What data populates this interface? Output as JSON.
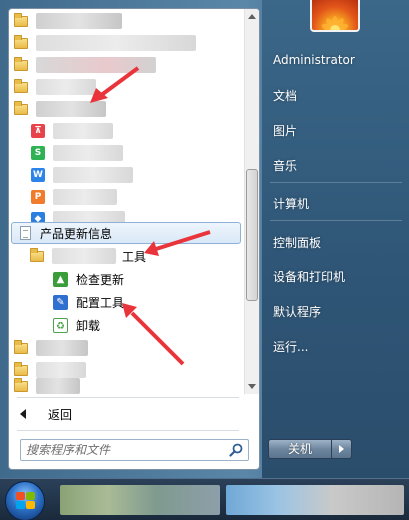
{
  "programs": {
    "app_icons": [
      {
        "name": "wps-pdf-icon",
        "glyph": "⊼",
        "color": "#e8434b"
      },
      {
        "name": "wps-spreadsheet-icon",
        "glyph": "S",
        "color": "#2fb254"
      },
      {
        "name": "wps-writer-icon",
        "glyph": "W",
        "color": "#2d84e8"
      },
      {
        "name": "wps-presentation-icon",
        "glyph": "P",
        "color": "#f07b2a"
      },
      {
        "name": "cube-app-icon",
        "glyph": "◆",
        "color": "#2b7fe0"
      }
    ],
    "selected_item": "产品更新信息",
    "folder_suffix": "工具",
    "sub_items": [
      {
        "label": "检查更新",
        "icon": "check-update-icon",
        "color": "#3b9c3a"
      },
      {
        "label": "配置工具",
        "icon": "wrench-icon",
        "color": "#2f6fd0"
      },
      {
        "label": "卸载",
        "icon": "uninstall-icon",
        "color": "#4da34b"
      }
    ]
  },
  "back_label": "返回",
  "search": {
    "placeholder": "搜索程序和文件"
  },
  "right_menu": {
    "items": [
      "Administrator",
      "文档",
      "图片",
      "音乐",
      "计算机",
      "控制面板",
      "设备和打印机",
      "默认程序",
      "运行..."
    ]
  },
  "shutdown_label": "关机",
  "colors": {
    "arrow_red": "#e8343a",
    "selection_border": "#8fb1d6",
    "menu_blue": "#2f5677"
  }
}
